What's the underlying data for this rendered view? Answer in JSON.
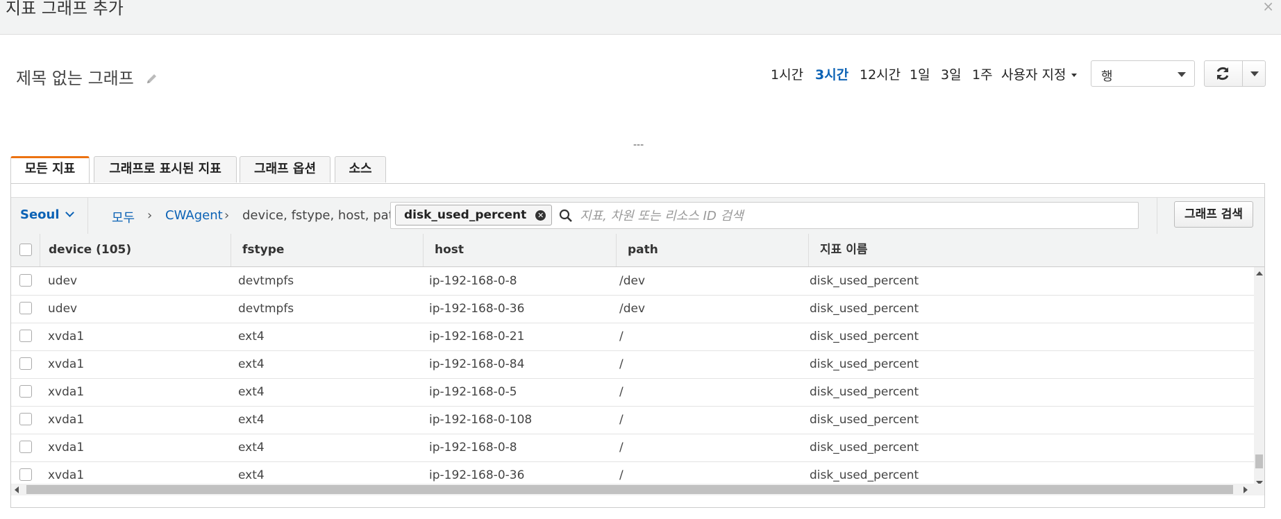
{
  "dialog": {
    "title": "지표 그래프 추가",
    "close_symbol": "×"
  },
  "graph": {
    "title": "제목 없는 그래프"
  },
  "time_ranges": {
    "items": [
      "1시간",
      "3시간",
      "12시간",
      "1일",
      "3일",
      "1주"
    ],
    "selected": "3시간",
    "custom_label": "사용자 지정"
  },
  "view_select": {
    "value": "행"
  },
  "separator_text": "---",
  "tabs": [
    {
      "label": "모든 지표",
      "active": true
    },
    {
      "label": "그래프로 표시된 지표",
      "active": false
    },
    {
      "label": "그래프 옵션",
      "active": false
    },
    {
      "label": "소스",
      "active": false
    }
  ],
  "toolbar": {
    "region": "Seoul",
    "breadcrumb": [
      "모두",
      "CWAgent",
      "device, fstype, host, path"
    ],
    "filter_chip": "disk_used_percent",
    "search_placeholder": "지표, 차원 또는 리소스 ID 검색",
    "graph_search_button": "그래프 검색"
  },
  "table": {
    "columns": [
      "device (105)",
      "fstype",
      "host",
      "path",
      "지표 이름"
    ],
    "rows": [
      [
        "udev",
        "devtmpfs",
        "ip-192-168-0-8",
        "/dev",
        "disk_used_percent"
      ],
      [
        "udev",
        "devtmpfs",
        "ip-192-168-0-36",
        "/dev",
        "disk_used_percent"
      ],
      [
        "xvda1",
        "ext4",
        "ip-192-168-0-21",
        "/",
        "disk_used_percent"
      ],
      [
        "xvda1",
        "ext4",
        "ip-192-168-0-84",
        "/",
        "disk_used_percent"
      ],
      [
        "xvda1",
        "ext4",
        "ip-192-168-0-5",
        "/",
        "disk_used_percent"
      ],
      [
        "xvda1",
        "ext4",
        "ip-192-168-0-108",
        "/",
        "disk_used_percent"
      ],
      [
        "xvda1",
        "ext4",
        "ip-192-168-0-8",
        "/",
        "disk_used_percent"
      ],
      [
        "xvda1",
        "ext4",
        "ip-192-168-0-36",
        "/",
        "disk_used_percent"
      ]
    ]
  },
  "colors": {
    "accent": "#ec7211",
    "link": "#0b62b5"
  },
  "icons": {
    "edit": "pencil-icon",
    "refresh": "refresh-icon",
    "search": "search-icon",
    "remove": "close-circle-icon"
  }
}
